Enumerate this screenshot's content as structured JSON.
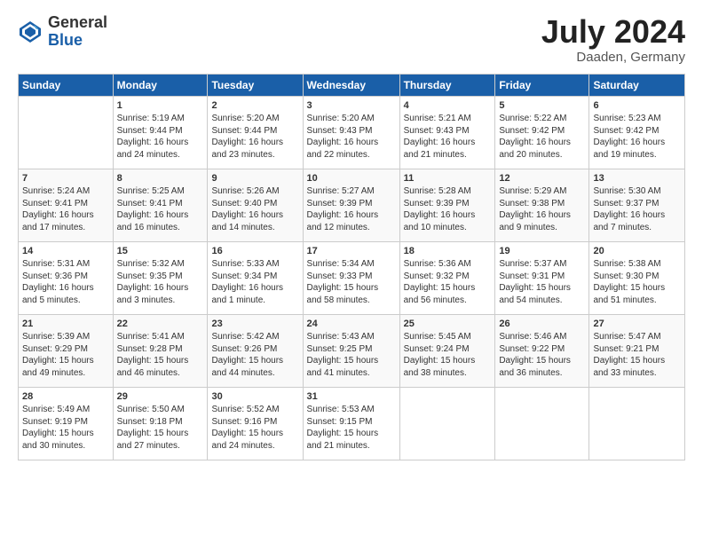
{
  "header": {
    "logo_general": "General",
    "logo_blue": "Blue",
    "month_year": "July 2024",
    "location": "Daaden, Germany"
  },
  "days_of_week": [
    "Sunday",
    "Monday",
    "Tuesday",
    "Wednesday",
    "Thursday",
    "Friday",
    "Saturday"
  ],
  "weeks": [
    [
      {
        "day": "",
        "sunrise": "",
        "sunset": "",
        "daylight": ""
      },
      {
        "day": "1",
        "sunrise": "Sunrise: 5:19 AM",
        "sunset": "Sunset: 9:44 PM",
        "daylight": "Daylight: 16 hours and 24 minutes."
      },
      {
        "day": "2",
        "sunrise": "Sunrise: 5:20 AM",
        "sunset": "Sunset: 9:44 PM",
        "daylight": "Daylight: 16 hours and 23 minutes."
      },
      {
        "day": "3",
        "sunrise": "Sunrise: 5:20 AM",
        "sunset": "Sunset: 9:43 PM",
        "daylight": "Daylight: 16 hours and 22 minutes."
      },
      {
        "day": "4",
        "sunrise": "Sunrise: 5:21 AM",
        "sunset": "Sunset: 9:43 PM",
        "daylight": "Daylight: 16 hours and 21 minutes."
      },
      {
        "day": "5",
        "sunrise": "Sunrise: 5:22 AM",
        "sunset": "Sunset: 9:42 PM",
        "daylight": "Daylight: 16 hours and 20 minutes."
      },
      {
        "day": "6",
        "sunrise": "Sunrise: 5:23 AM",
        "sunset": "Sunset: 9:42 PM",
        "daylight": "Daylight: 16 hours and 19 minutes."
      }
    ],
    [
      {
        "day": "7",
        "sunrise": "Sunrise: 5:24 AM",
        "sunset": "Sunset: 9:41 PM",
        "daylight": "Daylight: 16 hours and 17 minutes."
      },
      {
        "day": "8",
        "sunrise": "Sunrise: 5:25 AM",
        "sunset": "Sunset: 9:41 PM",
        "daylight": "Daylight: 16 hours and 16 minutes."
      },
      {
        "day": "9",
        "sunrise": "Sunrise: 5:26 AM",
        "sunset": "Sunset: 9:40 PM",
        "daylight": "Daylight: 16 hours and 14 minutes."
      },
      {
        "day": "10",
        "sunrise": "Sunrise: 5:27 AM",
        "sunset": "Sunset: 9:39 PM",
        "daylight": "Daylight: 16 hours and 12 minutes."
      },
      {
        "day": "11",
        "sunrise": "Sunrise: 5:28 AM",
        "sunset": "Sunset: 9:39 PM",
        "daylight": "Daylight: 16 hours and 10 minutes."
      },
      {
        "day": "12",
        "sunrise": "Sunrise: 5:29 AM",
        "sunset": "Sunset: 9:38 PM",
        "daylight": "Daylight: 16 hours and 9 minutes."
      },
      {
        "day": "13",
        "sunrise": "Sunrise: 5:30 AM",
        "sunset": "Sunset: 9:37 PM",
        "daylight": "Daylight: 16 hours and 7 minutes."
      }
    ],
    [
      {
        "day": "14",
        "sunrise": "Sunrise: 5:31 AM",
        "sunset": "Sunset: 9:36 PM",
        "daylight": "Daylight: 16 hours and 5 minutes."
      },
      {
        "day": "15",
        "sunrise": "Sunrise: 5:32 AM",
        "sunset": "Sunset: 9:35 PM",
        "daylight": "Daylight: 16 hours and 3 minutes."
      },
      {
        "day": "16",
        "sunrise": "Sunrise: 5:33 AM",
        "sunset": "Sunset: 9:34 PM",
        "daylight": "Daylight: 16 hours and 1 minute."
      },
      {
        "day": "17",
        "sunrise": "Sunrise: 5:34 AM",
        "sunset": "Sunset: 9:33 PM",
        "daylight": "Daylight: 15 hours and 58 minutes."
      },
      {
        "day": "18",
        "sunrise": "Sunrise: 5:36 AM",
        "sunset": "Sunset: 9:32 PM",
        "daylight": "Daylight: 15 hours and 56 minutes."
      },
      {
        "day": "19",
        "sunrise": "Sunrise: 5:37 AM",
        "sunset": "Sunset: 9:31 PM",
        "daylight": "Daylight: 15 hours and 54 minutes."
      },
      {
        "day": "20",
        "sunrise": "Sunrise: 5:38 AM",
        "sunset": "Sunset: 9:30 PM",
        "daylight": "Daylight: 15 hours and 51 minutes."
      }
    ],
    [
      {
        "day": "21",
        "sunrise": "Sunrise: 5:39 AM",
        "sunset": "Sunset: 9:29 PM",
        "daylight": "Daylight: 15 hours and 49 minutes."
      },
      {
        "day": "22",
        "sunrise": "Sunrise: 5:41 AM",
        "sunset": "Sunset: 9:28 PM",
        "daylight": "Daylight: 15 hours and 46 minutes."
      },
      {
        "day": "23",
        "sunrise": "Sunrise: 5:42 AM",
        "sunset": "Sunset: 9:26 PM",
        "daylight": "Daylight: 15 hours and 44 minutes."
      },
      {
        "day": "24",
        "sunrise": "Sunrise: 5:43 AM",
        "sunset": "Sunset: 9:25 PM",
        "daylight": "Daylight: 15 hours and 41 minutes."
      },
      {
        "day": "25",
        "sunrise": "Sunrise: 5:45 AM",
        "sunset": "Sunset: 9:24 PM",
        "daylight": "Daylight: 15 hours and 38 minutes."
      },
      {
        "day": "26",
        "sunrise": "Sunrise: 5:46 AM",
        "sunset": "Sunset: 9:22 PM",
        "daylight": "Daylight: 15 hours and 36 minutes."
      },
      {
        "day": "27",
        "sunrise": "Sunrise: 5:47 AM",
        "sunset": "Sunset: 9:21 PM",
        "daylight": "Daylight: 15 hours and 33 minutes."
      }
    ],
    [
      {
        "day": "28",
        "sunrise": "Sunrise: 5:49 AM",
        "sunset": "Sunset: 9:19 PM",
        "daylight": "Daylight: 15 hours and 30 minutes."
      },
      {
        "day": "29",
        "sunrise": "Sunrise: 5:50 AM",
        "sunset": "Sunset: 9:18 PM",
        "daylight": "Daylight: 15 hours and 27 minutes."
      },
      {
        "day": "30",
        "sunrise": "Sunrise: 5:52 AM",
        "sunset": "Sunset: 9:16 PM",
        "daylight": "Daylight: 15 hours and 24 minutes."
      },
      {
        "day": "31",
        "sunrise": "Sunrise: 5:53 AM",
        "sunset": "Sunset: 9:15 PM",
        "daylight": "Daylight: 15 hours and 21 minutes."
      },
      {
        "day": "",
        "sunrise": "",
        "sunset": "",
        "daylight": ""
      },
      {
        "day": "",
        "sunrise": "",
        "sunset": "",
        "daylight": ""
      },
      {
        "day": "",
        "sunrise": "",
        "sunset": "",
        "daylight": ""
      }
    ]
  ]
}
